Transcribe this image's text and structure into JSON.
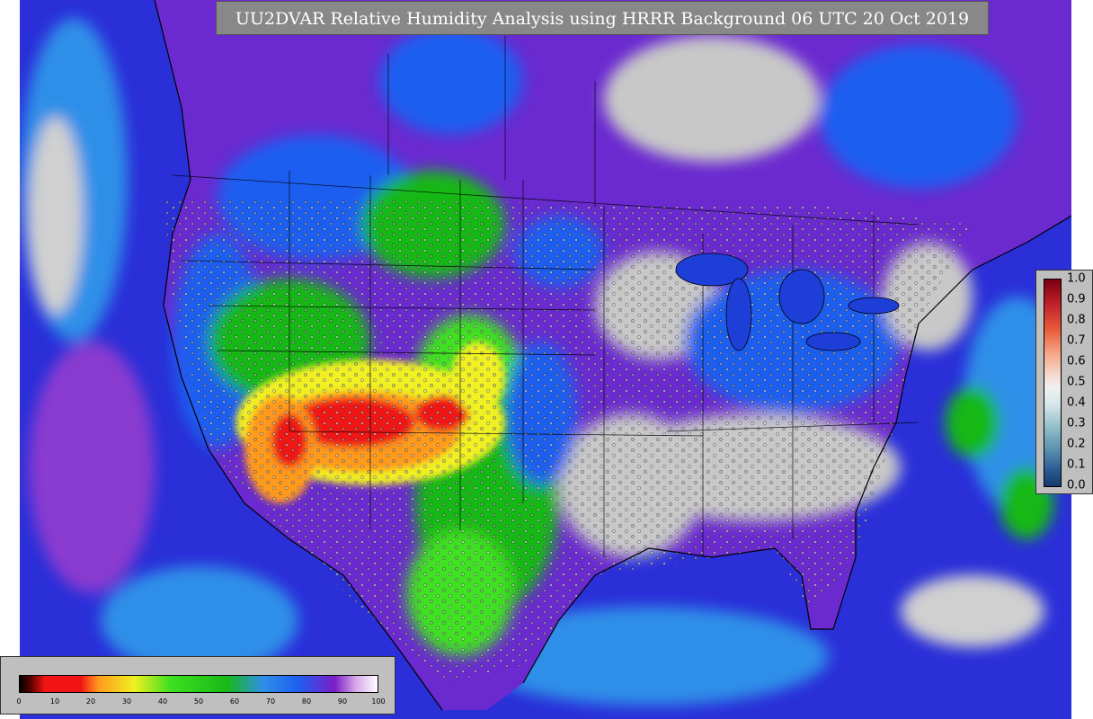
{
  "title": "UU2DVAR Relative Humidity Analysis using HRRR Background 06 UTC 20 Oct 2019",
  "colors": {
    "ocean": "#2a2fd8",
    "ocean_light": "#2f8fe8",
    "very_humid": "#7a1ec8",
    "saturated": "#c8c8c8",
    "moist": "#1e5ef0",
    "green": "#18b818",
    "bright_green": "#40e020",
    "yellow": "#f0f020",
    "orange": "#ff9a1e",
    "red": "#f01414",
    "land_gray": "#d0d0d0"
  },
  "rh_colorbar": {
    "ticks": [
      "0",
      "10",
      "20",
      "30",
      "40",
      "50",
      "60",
      "70",
      "80",
      "90",
      "100"
    ]
  },
  "innovation_colorbar": {
    "ticks": [
      "1.0",
      "0.9",
      "0.8",
      "0.7",
      "0.6",
      "0.5",
      "0.4",
      "0.3",
      "0.2",
      "0.1",
      "0.0"
    ]
  }
}
